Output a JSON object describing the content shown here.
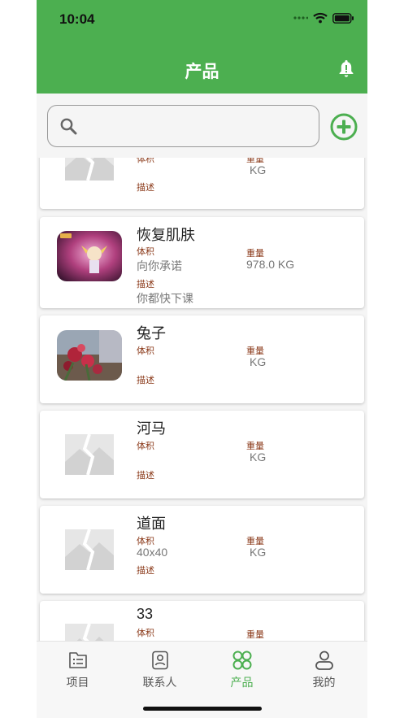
{
  "status": {
    "time": "10:04"
  },
  "header": {
    "title": "产品"
  },
  "search": {
    "placeholder": ""
  },
  "labels": {
    "volume": "体积",
    "weight": "重量",
    "description": "描述"
  },
  "products": [
    {
      "name": "",
      "volume": "",
      "weight": "KG",
      "description": "",
      "image": "placeholder"
    },
    {
      "name": "恢复肌肤",
      "volume": "向你承诺",
      "weight": "978.0 KG",
      "description": "你都快下课",
      "image": "photo-anime"
    },
    {
      "name": "兔子",
      "volume": "",
      "weight": "KG",
      "description": "",
      "image": "photo-flowers"
    },
    {
      "name": "河马",
      "volume": "",
      "weight": "KG",
      "description": "",
      "image": "placeholder"
    },
    {
      "name": "道面",
      "volume": "40x40",
      "weight": "KG",
      "description": "",
      "image": "placeholder"
    },
    {
      "name": "33",
      "volume": "",
      "weight": "",
      "description": "",
      "image": "placeholder"
    }
  ],
  "tabs": [
    {
      "label": "项目",
      "icon": "list-icon"
    },
    {
      "label": "联系人",
      "icon": "contacts-icon"
    },
    {
      "label": "产品",
      "icon": "clover-icon",
      "active": true
    },
    {
      "label": "我的",
      "icon": "person-icon"
    }
  ],
  "colors": {
    "primary": "#4CAF50",
    "label": "#8B3A1A"
  }
}
